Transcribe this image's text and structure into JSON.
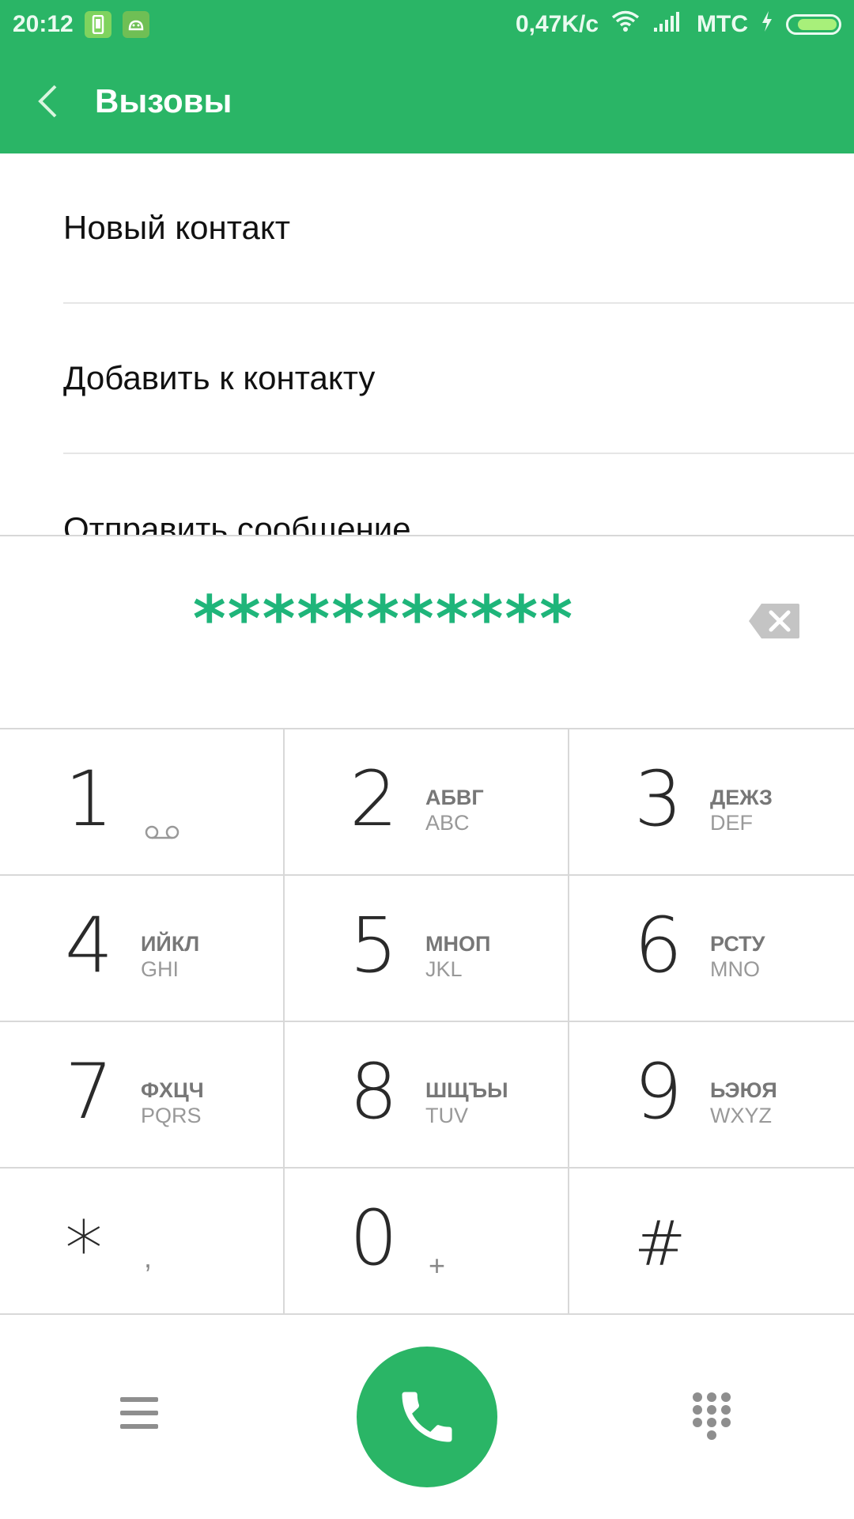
{
  "status_bar": {
    "time": "20:12",
    "network_speed": "0,47K/c",
    "carrier": "МТС",
    "battery_level": 0.85,
    "icons": [
      "sim-notification-icon",
      "android-notification-icon",
      "wifi-icon",
      "signal-icon",
      "charging-icon",
      "battery-icon"
    ]
  },
  "header": {
    "title": "Вызовы",
    "back_icon": "chevron-left-icon",
    "background_color": "#2ab566"
  },
  "options": [
    {
      "label": "Новый контакт"
    },
    {
      "label": "Добавить к контакту"
    },
    {
      "label": "Отправить сообщение"
    }
  ],
  "dial_display": {
    "number": "***********",
    "number_color": "#1fb57a",
    "backspace_icon": "backspace-icon"
  },
  "keypad": [
    {
      "digit": "1",
      "extra_icon": "voicemail-icon"
    },
    {
      "digit": "2",
      "letters_ru": "АБВГ",
      "letters_en": "ABC"
    },
    {
      "digit": "3",
      "letters_ru": "ДЕЖЗ",
      "letters_en": "DEF"
    },
    {
      "digit": "4",
      "letters_ru": "ИЙКЛ",
      "letters_en": "GHI"
    },
    {
      "digit": "5",
      "letters_ru": "МНОП",
      "letters_en": "JKL"
    },
    {
      "digit": "6",
      "letters_ru": "РСТУ",
      "letters_en": "MNO"
    },
    {
      "digit": "7",
      "letters_ru": "ФХЦЧ",
      "letters_en": "PQRS"
    },
    {
      "digit": "8",
      "letters_ru": "ШЩЪЫ",
      "letters_en": "TUV"
    },
    {
      "digit": "9",
      "letters_ru": "ЬЭЮЯ",
      "letters_en": "WXYZ"
    },
    {
      "digit": "*",
      "extra": ","
    },
    {
      "digit": "0",
      "extra": "+"
    },
    {
      "digit": "#"
    }
  ],
  "bottom_bar": {
    "menu_icon": "menu-icon",
    "call_icon": "phone-icon",
    "dialpad_icon": "dialpad-icon",
    "call_button_color": "#2ab566"
  }
}
